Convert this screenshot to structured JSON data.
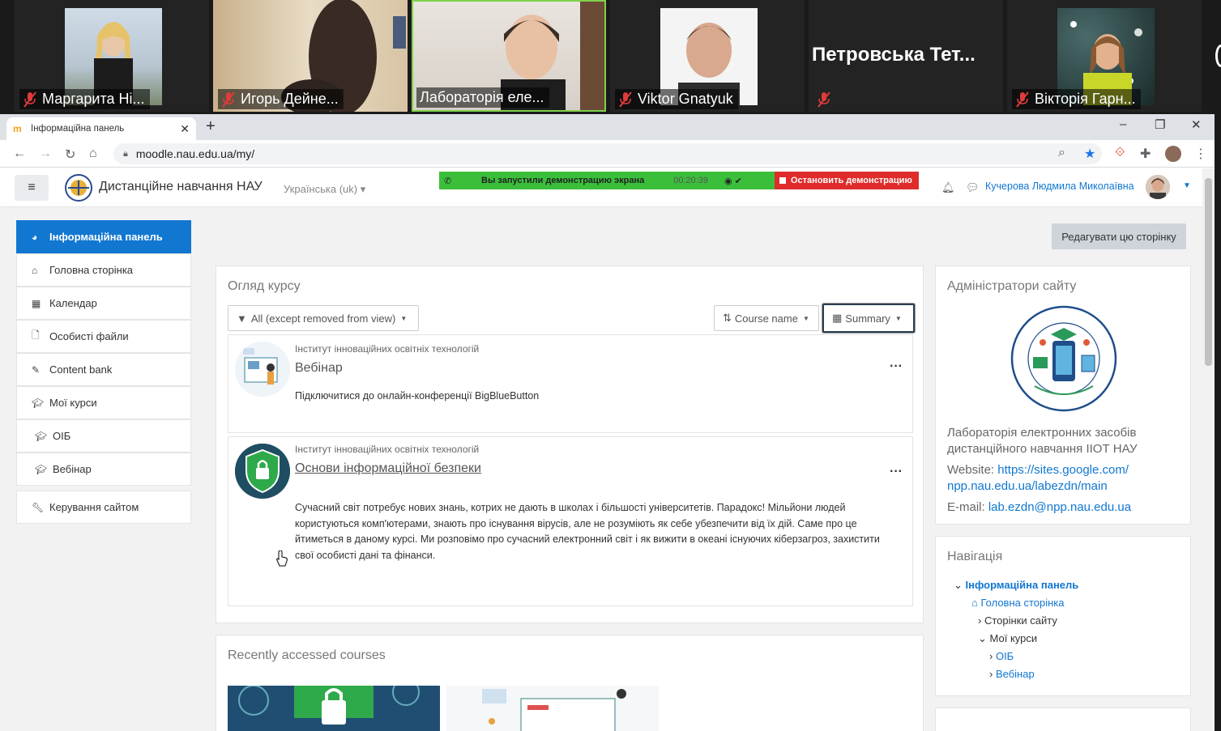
{
  "meeting": {
    "participants": [
      {
        "name": "Маргарита Ні..."
      },
      {
        "name": "Игорь Дейне..."
      },
      {
        "name": "Лабораторія еле..."
      },
      {
        "name": "Viktor Gnatyuk"
      },
      {
        "name": "Петровська  Тет..."
      },
      {
        "name": "Вікторія Гарн..."
      }
    ]
  },
  "browser": {
    "tab_title": "Інформаційна панель",
    "url": "moodle.nau.edu.ua/my/",
    "window_controls": [
      "–",
      "❐",
      "✕"
    ]
  },
  "header": {
    "site_name": "Дистанційне навчання НАУ",
    "language": "Українська (uk) ▾",
    "share_text": "Вы запустили демонстрацию экрана",
    "share_timer": "00:20:39",
    "stop_label": "Остановить демонстрацию",
    "user_name": "Кучерова Людмила Миколаївна"
  },
  "leftnav": {
    "items": [
      {
        "label": "Інформаційна панель",
        "icon": "dashboard-icon"
      },
      {
        "label": "Головна сторінка",
        "icon": "home-icon"
      },
      {
        "label": "Календар",
        "icon": "calendar-icon"
      },
      {
        "label": "Особисті файли",
        "icon": "file-icon"
      },
      {
        "label": "Content bank",
        "icon": "brush-icon"
      },
      {
        "label": "Мої курси",
        "icon": "graduation-cap-icon"
      },
      {
        "label": "ОІБ",
        "icon": "graduation-cap-icon"
      },
      {
        "label": "Вебінар",
        "icon": "graduation-cap-icon"
      },
      {
        "label": "Керування сайтом",
        "icon": "wrench-icon"
      }
    ]
  },
  "edit_page_label": "Редагувати цю сторінку",
  "course_overview": {
    "title": "Огляд курсу",
    "filter": "All (except removed from view)",
    "sort": "Course name",
    "view": "Summary",
    "courses": [
      {
        "category": "Інститут інноваційних освітніх технологій",
        "name": "Вебінар",
        "summary": "Підключитися до онлайн-конференції BigBlueButton"
      },
      {
        "category": "Інститут інноваційних освітніх технологій",
        "name": "Основи інформаційної безпеки",
        "summary": "Сучасний світ потребує нових знань, котрих не дають в школах і більшості університетів. Парадокс! Мільйони людей користуються комп'ютерами, знають про існування вірусів, але не розуміють як себе убезпечити від їх дій. Саме про це йтиметься в даному курсі. Ми розповімо про сучасний електронний світ і як вижити в океані існуючих кіберзагроз, захистити свої особисті дані та фінанси."
      }
    ]
  },
  "recent": {
    "title": "Recently accessed courses"
  },
  "admins": {
    "title": "Адміністратори сайту",
    "org_line1": "Лабораторія електронних засобів",
    "org_line2": "дистанційного навчання ІІОТ НАУ",
    "website_label": "Website:",
    "website_line1": "https://sites.google.com/",
    "website_line2": "npp.nau.edu.ua/labezdn/main",
    "email_label": "E-mail:",
    "email": "lab.ezdn@npp.nau.edu.ua",
    "logo_text": "Лабораторія електронних засобів · дистанційного навчання НАУ"
  },
  "navigation": {
    "title": "Навігація",
    "items": [
      {
        "label": "Інформаційна панель"
      },
      {
        "label": "Головна сторінка"
      },
      {
        "label": "Сторінки сайту"
      },
      {
        "label": "Мої курси"
      },
      {
        "label": "ОІБ"
      },
      {
        "label": "Вебінар"
      }
    ]
  },
  "colors": {
    "accent": "#1177d1",
    "share_green": "#3bbf3b",
    "stop_red": "#e02b2b"
  }
}
